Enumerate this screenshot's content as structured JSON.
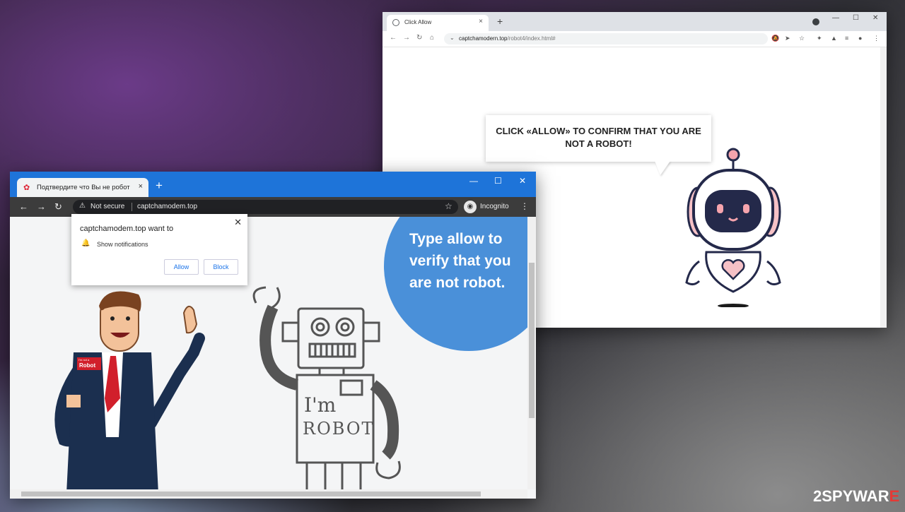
{
  "right_window": {
    "tab_title": "Click Allow",
    "tab_close": "×",
    "newtab": "+",
    "window_controls": [
      "—",
      "☐",
      "✕"
    ],
    "url_host": "captchamodern.top",
    "url_path": "/robot4/index.html#",
    "bubble_text": "CLICK «ALLOW» TO CONFIRM THAT YOU ARE NOT A ROBOT!"
  },
  "left_window": {
    "tab_title": "Подтвердите что Вы не робот",
    "tab_close": "×",
    "newtab": "+",
    "window_controls": [
      "—",
      "☐",
      "✕"
    ],
    "security_label": "Not secure",
    "url": "captchamodem.top",
    "incognito_label": "Incognito",
    "circle_text": "Type allow to verify that you are not robot.",
    "badge_line1": "I'm not a",
    "badge_line2": "Robot",
    "robot_text1": "I'm",
    "robot_text2": "ROBOT"
  },
  "notification": {
    "title": "captchamodem.top want to",
    "permission": "Show notifications",
    "allow_label": "Allow",
    "block_label": "Block",
    "close": "✕"
  },
  "watermark": {
    "part1": "2SPYWAR",
    "part2": "E"
  },
  "icons": [
    "lock-icon",
    "back-icon",
    "forward-icon",
    "reload-icon",
    "home-icon",
    "bell-icon",
    "star-icon",
    "extensions-icon",
    "incognito-icon",
    "menu-icon",
    "warning-icon"
  ],
  "colors": {
    "left_tabbar": "#1e74d9",
    "circle": "#4a90d9",
    "robot_pink": "#f6c1c6",
    "robot_navy": "#24294a",
    "watermark_red": "#e53935"
  }
}
